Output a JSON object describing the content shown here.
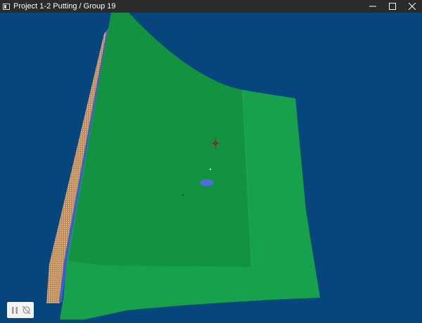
{
  "window": {
    "title": "Project 1-2 Putting / Group 19",
    "icon": "window-app-icon",
    "controls": [
      "minimize-icon",
      "maximize-icon",
      "close-icon"
    ]
  },
  "scene": {
    "background_color": "#06467d",
    "green_color": "#17a14d",
    "green_shade_color": "#13923f",
    "wall_color": "#c18d5d",
    "edge_color": "#3a5fd0",
    "hole_color": "#4c6ed6",
    "crosshair_color": "#7d3a3a"
  },
  "hud": {
    "buttons": [
      "pause-icon",
      "camera-off-icon"
    ]
  }
}
